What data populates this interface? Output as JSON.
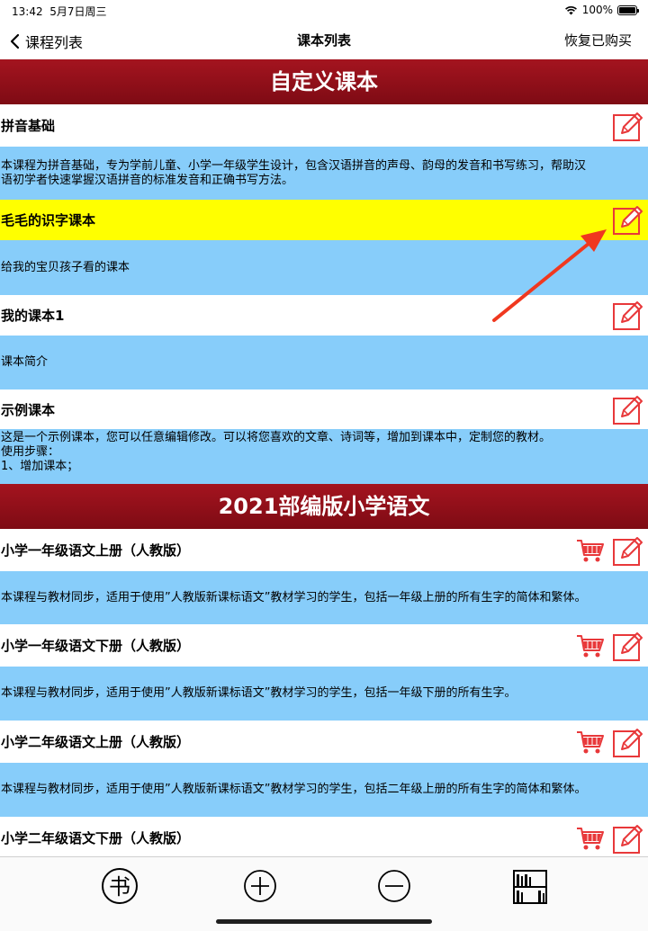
{
  "status": {
    "time": "13:42",
    "date": "5月7日周三",
    "battery": "100%",
    "battery_level": 1.0
  },
  "nav": {
    "back_label": "课程列表",
    "title": "课本列表",
    "right_label": "恢复已购买"
  },
  "sections": [
    {
      "title": "自定义课本",
      "courses": [
        {
          "title": "拼音基础",
          "desc_lines": [
            "本课程为拼音基础，专为学前儿童、小学一年级学生设计，包含汉语拼音的声母、韵母的发音和书写练习，帮助汉",
            "语初学者快速掌握汉语拼音的标准发音和正确书写方法。"
          ]
        },
        {
          "title": "毛毛的识字课本",
          "highlighted": true,
          "desc_lines": [
            "给我的宝贝孩子看的课本"
          ]
        },
        {
          "title": "我的课本1",
          "desc_lines": [
            "课本简介"
          ]
        },
        {
          "title": "示例课本",
          "desc_lines": [
            "这是一个示例课本，您可以任意编辑修改。可以将您喜欢的文章、诗词等，增加到课本中，定制您的教材。",
            "使用步骤：",
            "1、增加课本；"
          ]
        }
      ]
    },
    {
      "title": "2021部编版小学语文",
      "courses": [
        {
          "title": "小学一年级语文上册（人教版）",
          "desc_lines": [
            "本课程与教材同步，适用于使用”人教版新课标语文”教材学习的学生，包括一年级上册的所有生字的简体和繁体。"
          ]
        },
        {
          "title": "小学一年级语文下册（人教版）",
          "desc_lines": [
            "本课程与教材同步，适用于使用”人教版新课标语文”教材学习的学生，包括一年级下册的所有生字。"
          ]
        },
        {
          "title": "小学二年级语文上册（人教版）",
          "desc_lines": [
            "本课程与教材同步，适用于使用”人教版新课标语文”教材学习的学生，包括二年级上册的所有生字的简体和繁体。"
          ]
        },
        {
          "title": "小学二年级语文下册（人教版）",
          "desc_lines": []
        }
      ]
    }
  ],
  "tabbar": {
    "book_glyph": "书",
    "items": [
      "book-icon",
      "plus-circle-icon",
      "minus-circle-icon",
      "bookshelf-icon"
    ]
  },
  "colors": {
    "header_red": "#8e0f18",
    "desc_blue": "#87cdfa",
    "highlight_yellow": "#ffff00",
    "icon_red": "#e8383a",
    "arrow_red": "#f0381f"
  }
}
